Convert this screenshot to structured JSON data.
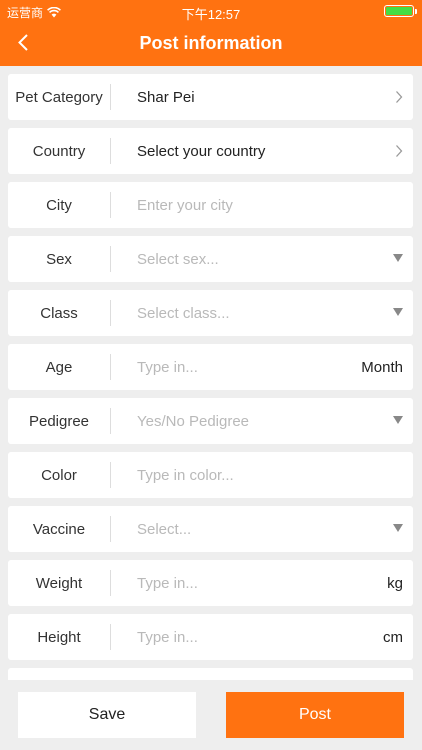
{
  "status_bar": {
    "carrier": "运营商",
    "time": "下午12:57"
  },
  "header": {
    "title": "Post information"
  },
  "form": [
    {
      "label": "Pet Category",
      "value": "Shar Pei",
      "placeholder": false,
      "accessory": "chevron",
      "unit": ""
    },
    {
      "label": "Country",
      "value": "Select your country",
      "placeholder": false,
      "accessory": "chevron",
      "unit": ""
    },
    {
      "label": "City",
      "value": "Enter your city",
      "placeholder": true,
      "accessory": "none",
      "unit": ""
    },
    {
      "label": "Sex",
      "value": "Select sex...",
      "placeholder": true,
      "accessory": "caret",
      "unit": ""
    },
    {
      "label": "Class",
      "value": "Select class...",
      "placeholder": true,
      "accessory": "caret",
      "unit": ""
    },
    {
      "label": "Age",
      "value": "Type in...",
      "placeholder": true,
      "accessory": "unit",
      "unit": "Month"
    },
    {
      "label": "Pedigree",
      "value": "Yes/No Pedigree",
      "placeholder": true,
      "accessory": "caret",
      "unit": ""
    },
    {
      "label": "Color",
      "value": "Type in color...",
      "placeholder": true,
      "accessory": "none",
      "unit": ""
    },
    {
      "label": "Vaccine",
      "value": "Select...",
      "placeholder": true,
      "accessory": "caret",
      "unit": ""
    },
    {
      "label": "Weight",
      "value": "Type in...",
      "placeholder": true,
      "accessory": "unit",
      "unit": "kg"
    },
    {
      "label": "Height",
      "value": "Type in...",
      "placeholder": true,
      "accessory": "unit",
      "unit": "cm"
    }
  ],
  "buttons": {
    "save": "Save",
    "post": "Post"
  },
  "colors": {
    "accent": "#ff7211",
    "background": "#eeeeee",
    "placeholder": "#b9b9b9"
  }
}
